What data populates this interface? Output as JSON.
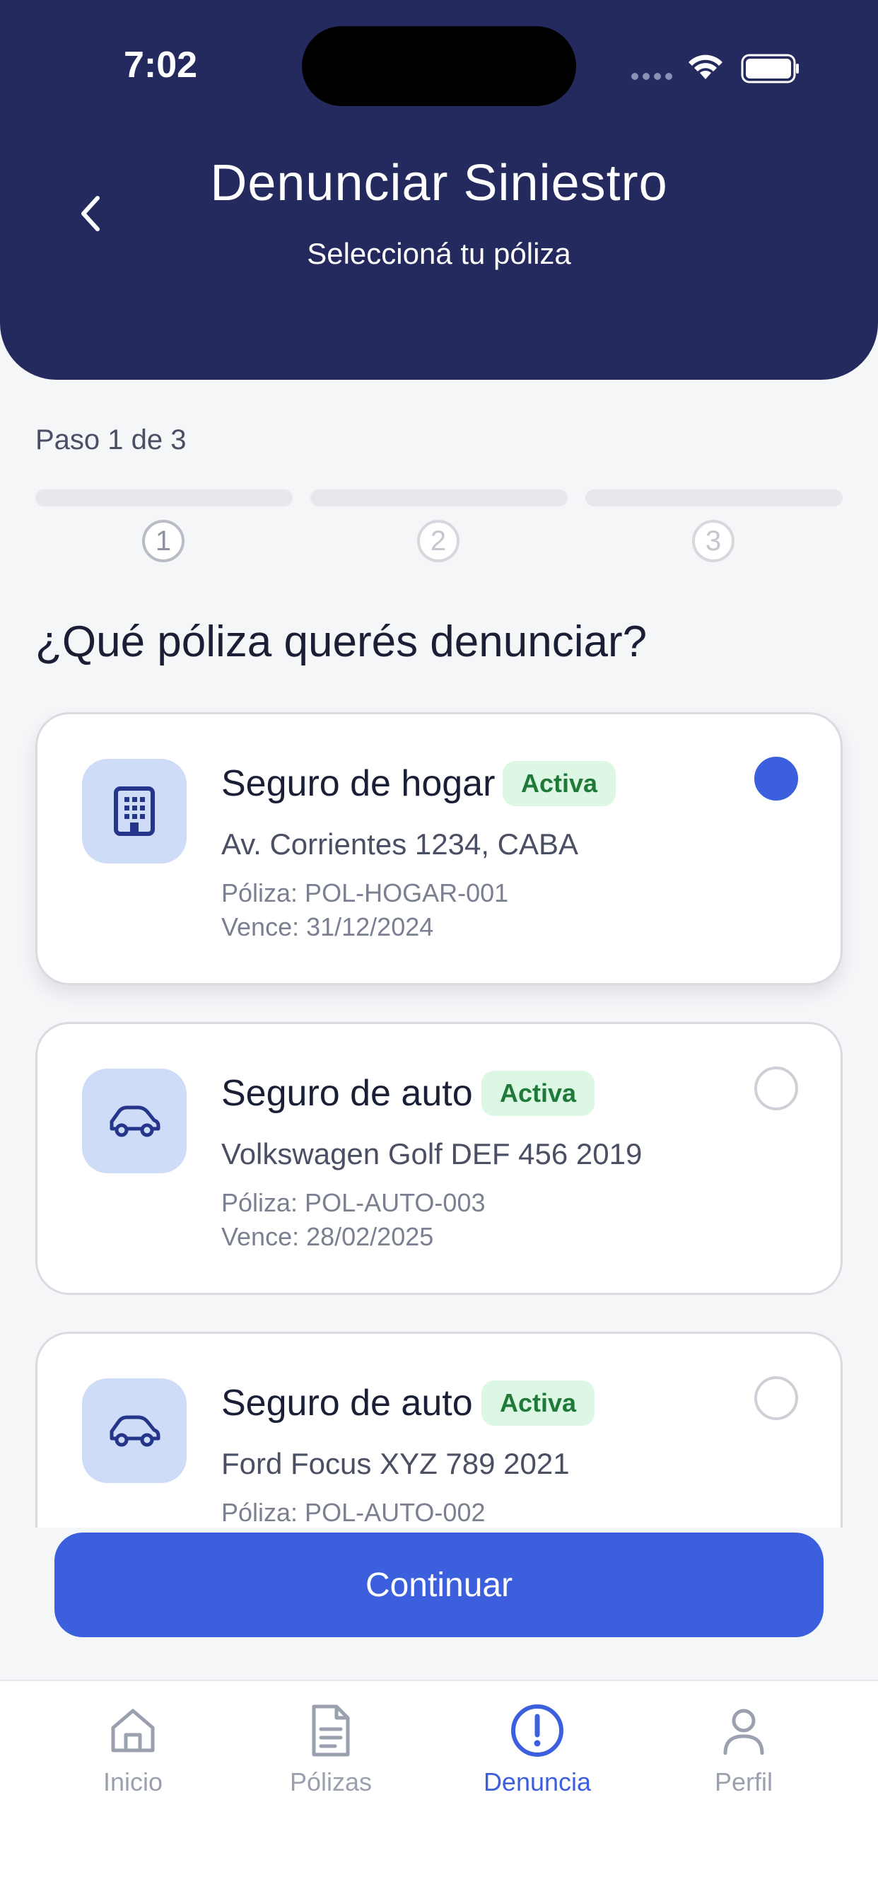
{
  "status_bar": {
    "time": "7:02"
  },
  "header": {
    "title": "Denunciar Siniestro",
    "subtitle": "Seleccioná tu póliza"
  },
  "stepper": {
    "label": "Paso 1 de 3",
    "current_step": 1,
    "steps": [
      "1",
      "2",
      "3"
    ]
  },
  "question": "¿Qué póliza querés denunciar?",
  "policies": [
    {
      "icon": "building-icon",
      "title": "Seguro de hogar",
      "status": "Activa",
      "detail": "Av. Corrientes 1234, CABA",
      "policy": "Póliza: POL-HOGAR-001",
      "expires": "Vence: 31/12/2024",
      "selected": true
    },
    {
      "icon": "car-icon",
      "title": "Seguro de auto",
      "status": "Activa",
      "detail": "Volkswagen Golf DEF 456 2019",
      "policy": "Póliza: POL-AUTO-003",
      "expires": "Vence: 28/02/2025",
      "selected": false
    },
    {
      "icon": "car-icon",
      "title": "Seguro de auto",
      "status": "Activa",
      "detail": "Ford Focus XYZ 789 2021",
      "policy": "Póliza: POL-AUTO-002",
      "expires": "",
      "selected": false
    }
  ],
  "continue_label": "Continuar",
  "nav": [
    {
      "label": "Inicio",
      "icon": "home-icon",
      "active": false
    },
    {
      "label": "Pólizas",
      "icon": "document-icon",
      "active": false
    },
    {
      "label": "Denuncia",
      "icon": "alert-icon",
      "active": true
    },
    {
      "label": "Perfil",
      "icon": "user-icon",
      "active": false
    }
  ],
  "colors": {
    "header_bg": "#24295e",
    "accent": "#3b5fdd",
    "badge_bg": "#dcf7e3",
    "badge_text": "#1f7a3a"
  }
}
